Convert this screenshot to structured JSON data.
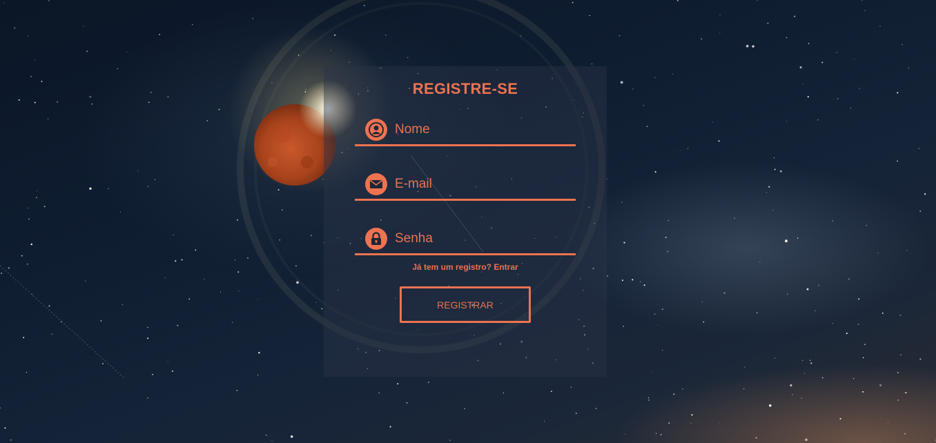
{
  "form": {
    "title": "REGISTRE-SE",
    "fields": [
      {
        "icon": "user-icon",
        "placeholder": "Nome",
        "value": ""
      },
      {
        "icon": "mail-icon",
        "placeholder": "E-mail",
        "value": ""
      },
      {
        "icon": "lock-icon",
        "placeholder": "Senha",
        "value": ""
      }
    ],
    "login_link": "Já tem um registro? Entrar",
    "submit_label": "REGISTRAR"
  },
  "colors": {
    "accent": "#ee7350",
    "panel": "#2a3446",
    "sky": "#0f1d31",
    "moon": "#b84a22"
  }
}
